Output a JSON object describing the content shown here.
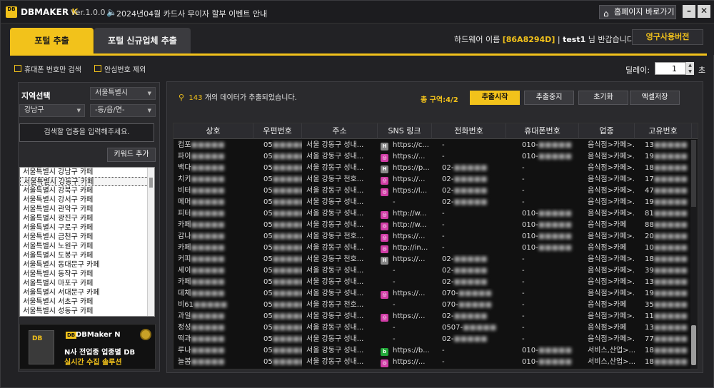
{
  "titlebar": {
    "logo": "DB",
    "app_name_prefix": "DBMAKER",
    "app_name_k": "K",
    "version": "Ver.1.0.0",
    "notice": "2024년04월 카드사 무이자 할부 이벤트 안내",
    "home_label": "홈페이지 바로가기"
  },
  "tabs": {
    "portal": "포털 추출",
    "new_business": "포털 신규업체 추출"
  },
  "hardware": {
    "label": "하드웨어 이름",
    "id": "[86A8294D]",
    "sep": "|",
    "user": "test1",
    "greeting": "님 반갑습니다!"
  },
  "permanent_button": "영구사용버전",
  "options": {
    "mobile_only": "휴대폰 번호만 검색",
    "safe_number_exclude": "안심번호 제외",
    "delay_label": "딜레이:",
    "delay_value": "1",
    "delay_unit": "초"
  },
  "left": {
    "region_title": "지역선택",
    "city_select": "서울특별시",
    "district_select": "강남구",
    "dong_select": "-동/읍/면-",
    "keyword_placeholder": "검색할 업종을 입력해주세요.",
    "keyword_add": "키워드 추가",
    "region_items": [
      "서울특별시 강남구 카페",
      "서울특별시 강동구 카페",
      "서울특별시 강북구 카페",
      "서울특별시 강서구 카페",
      "서울특별시 관악구 카페",
      "서울특별시 광진구 카페",
      "서울특별시 구로구 카페",
      "서울특별시 금천구 카페",
      "서울특별시 노원구 카페",
      "서울특별시 도봉구 카페",
      "서울특별시 동대문구 카페",
      "서울특별시 동작구 카페",
      "서울특별시 마포구 카페",
      "서울특별시 서대문구 카페",
      "서울특별시 서초구 카페",
      "서울특별시 성동구 카페"
    ],
    "banner": {
      "box_label": "DB",
      "tag": "DB",
      "brand": "DBMaker N",
      "line1": "N사 전업종 업종별 DB",
      "line2": "실시간 수집 솔루션"
    }
  },
  "main": {
    "count_prefix": "143",
    "count_suffix": "개의 데이터가 추출되었습니다.",
    "zone": "총 구역:4/2",
    "buttons": {
      "start": "추출시작",
      "stop": "추출중지",
      "reset": "초기화",
      "excel": "엑셀저장"
    },
    "columns": [
      "상호",
      "우편번호",
      "주소",
      "SNS 링크",
      "전화번호",
      "휴대폰번호",
      "업종",
      "고유번호"
    ],
    "rows": [
      {
        "name": "컴포",
        "zip": "05",
        "addr": "서울 강동구 성내...",
        "sns": "h",
        "link": "https://c...",
        "tel": "-",
        "mobile": "010-",
        "cat": "음식점>카페>...",
        "id": "13"
      },
      {
        "name": "파이",
        "zip": "05",
        "addr": "서울 강동구 성내...",
        "sns": "ig",
        "link": "https://...",
        "tel": "-",
        "mobile": "010-",
        "cat": "음식점>카페>...",
        "id": "19"
      },
      {
        "name": "백다",
        "zip": "05",
        "addr": "서울 강동구 성내...",
        "sns": "h",
        "link": "https://p...",
        "tel": "02-",
        "mobile": "-",
        "cat": "음식점>카페>...",
        "id": "18"
      },
      {
        "name": "치키",
        "zip": "05",
        "addr": "서울 강동구 천호...",
        "sns": "ig",
        "link": "https://...",
        "tel": "02-",
        "mobile": "-",
        "cat": "음식점>카페>...",
        "id": "17"
      },
      {
        "name": "비터",
        "zip": "05",
        "addr": "서울 강동구 성내...",
        "sns": "ig",
        "link": "https://l...",
        "tel": "02-",
        "mobile": "-",
        "cat": "음식점>카페>...",
        "id": "47"
      },
      {
        "name": "메머",
        "zip": "05",
        "addr": "서울 강동구 성내...",
        "sns": "",
        "link": "-",
        "tel": "02-",
        "mobile": "-",
        "cat": "음식점>카페>...",
        "id": "19"
      },
      {
        "name": "피터",
        "zip": "05",
        "addr": "서울 강동구 성내...",
        "sns": "ig",
        "link": "http://w...",
        "tel": "-",
        "mobile": "010-",
        "cat": "음식점>카페>...",
        "id": "81"
      },
      {
        "name": "카페",
        "zip": "05",
        "addr": "서울 강동구 성내...",
        "sns": "ig",
        "link": "http://w...",
        "tel": "-",
        "mobile": "010-",
        "cat": "음식점>카페",
        "id": "88"
      },
      {
        "name": "감나",
        "zip": "05",
        "addr": "서울 강동구 천호...",
        "sns": "ig",
        "link": "https://...",
        "tel": "-",
        "mobile": "010-",
        "cat": "음식점>카페>...",
        "id": "20"
      },
      {
        "name": "카페",
        "zip": "05",
        "addr": "서울 강동구 성내...",
        "sns": "ig",
        "link": "http://in...",
        "tel": "-",
        "mobile": "010-",
        "cat": "음식점>카페",
        "id": "10"
      },
      {
        "name": "커피",
        "zip": "05",
        "addr": "서울 강동구 천호...",
        "sns": "h",
        "link": "https://...",
        "tel": "02-",
        "mobile": "-",
        "cat": "음식점>카페>...",
        "id": "18"
      },
      {
        "name": "세이",
        "zip": "05",
        "addr": "서울 강동구 성내...",
        "sns": "",
        "link": "-",
        "tel": "02-",
        "mobile": "-",
        "cat": "음식점>카페>...",
        "id": "39"
      },
      {
        "name": "카페",
        "zip": "05",
        "addr": "서울 강동구 성내...",
        "sns": "",
        "link": "-",
        "tel": "02-",
        "mobile": "-",
        "cat": "음식점>카페>...",
        "id": "13"
      },
      {
        "name": "데체",
        "zip": "05",
        "addr": "서울 강동구 성내...",
        "sns": "ig",
        "link": "https://...",
        "tel": "070-",
        "mobile": "-",
        "cat": "음식점>카페>...",
        "id": "19"
      },
      {
        "name": "비61",
        "zip": "05",
        "addr": "서울 강동구 천호...",
        "sns": "",
        "link": "-",
        "tel": "070-",
        "mobile": "-",
        "cat": "음식점>카페",
        "id": "35"
      },
      {
        "name": "과일",
        "zip": "05",
        "addr": "서울 강동구 성내...",
        "sns": "ig",
        "link": "https://...",
        "tel": "02-",
        "mobile": "-",
        "cat": "음식점>카페>...",
        "id": "11"
      },
      {
        "name": "정성",
        "zip": "05",
        "addr": "서울 강동구 성내...",
        "sns": "",
        "link": "-",
        "tel": "0507-",
        "mobile": "-",
        "cat": "음식점>카페",
        "id": "13"
      },
      {
        "name": "떡과",
        "zip": "05",
        "addr": "서울 강동구 성내...",
        "sns": "",
        "link": "-",
        "tel": "02-",
        "mobile": "-",
        "cat": "음식점>카페>...",
        "id": "77"
      },
      {
        "name": "루나",
        "zip": "05",
        "addr": "서울 강동구 성내...",
        "sns": "b",
        "link": "https://b...",
        "tel": "-",
        "mobile": "010-",
        "cat": "서비스,산업>...",
        "id": "18"
      },
      {
        "name": "늘봄",
        "zip": "05",
        "addr": "서울 강동구 성내...",
        "sns": "ig",
        "link": "https://...",
        "tel": "-",
        "mobile": "010-",
        "cat": "서비스,산업>...",
        "id": "18"
      }
    ]
  },
  "colors": {
    "accent": "#f2c21b",
    "background": "#222225",
    "grid_background": "#111111",
    "instagram": "#d13da6",
    "blog": "#23a83a"
  },
  "icons": [
    "search-icon",
    "speaker-icon",
    "home-icon",
    "minimize-icon",
    "close-icon",
    "instagram-icon",
    "homepage-icon",
    "blog-icon",
    "medal-icon"
  ]
}
